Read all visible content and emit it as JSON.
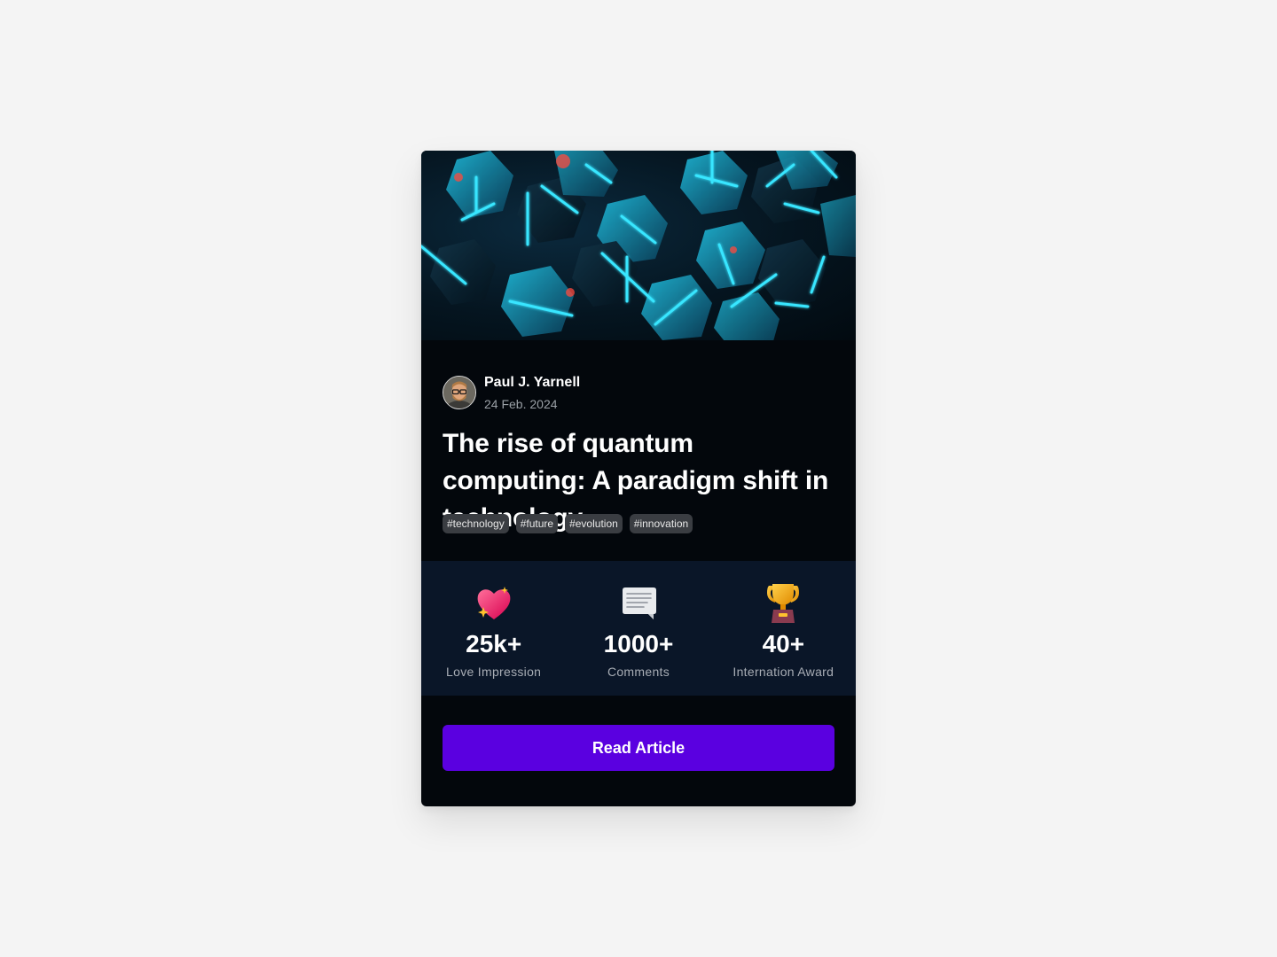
{
  "hero": {
    "image": "abstract-neon-cyan-polyhedra",
    "colors": {
      "glow": "#38e6ff",
      "accent": "#ff4a3d"
    }
  },
  "author": {
    "name": "Paul J. Yarnell",
    "date": "24 Feb. 2024",
    "avatar": "bearded-man-with-glasses-avatar"
  },
  "article": {
    "title": "The rise of quantum computing: A paradigm shift in technology",
    "tags": [
      "#technology",
      "#future",
      "#evolution",
      "#innovation"
    ]
  },
  "stats": [
    {
      "icon": "sparkling-heart-icon",
      "value": "25k+",
      "label": "Love Impression"
    },
    {
      "icon": "comment-bubble-icon",
      "value": "1000+",
      "label": "Comments"
    },
    {
      "icon": "trophy-icon",
      "value": "40+",
      "label": "Internation Award"
    }
  ],
  "cta": {
    "label": "Read Article",
    "color": "#5a00e0"
  },
  "theme": {
    "card_bg": "#03070c",
    "stats_bg": "#0a1628",
    "page_bg": "#f4f4f4"
  }
}
